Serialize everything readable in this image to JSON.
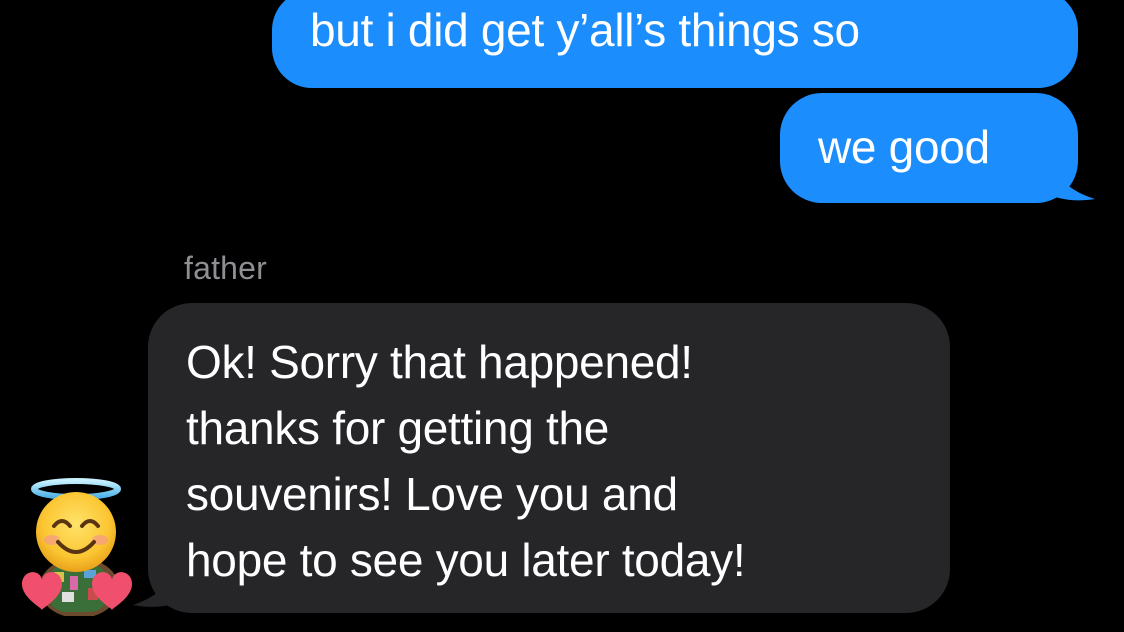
{
  "conversation": {
    "outgoing_messages": [
      {
        "text": "but i did get y’all’s things so"
      },
      {
        "text": "we good"
      }
    ],
    "incoming_group": {
      "sender_name": "father",
      "avatar_icon": "smiling-face-with-halo-and-hearts-icon",
      "message_lines": [
        "Ok! Sorry that happened!",
        "thanks for getting the",
        "souvenirs! Love you and",
        "hope to see you later today!"
      ]
    }
  },
  "colors": {
    "background": "#000000",
    "outgoing_bubble": "#1b8dfc",
    "incoming_bubble": "#262629",
    "sender_name": "#8e8e93",
    "message_text": "#ffffff"
  }
}
